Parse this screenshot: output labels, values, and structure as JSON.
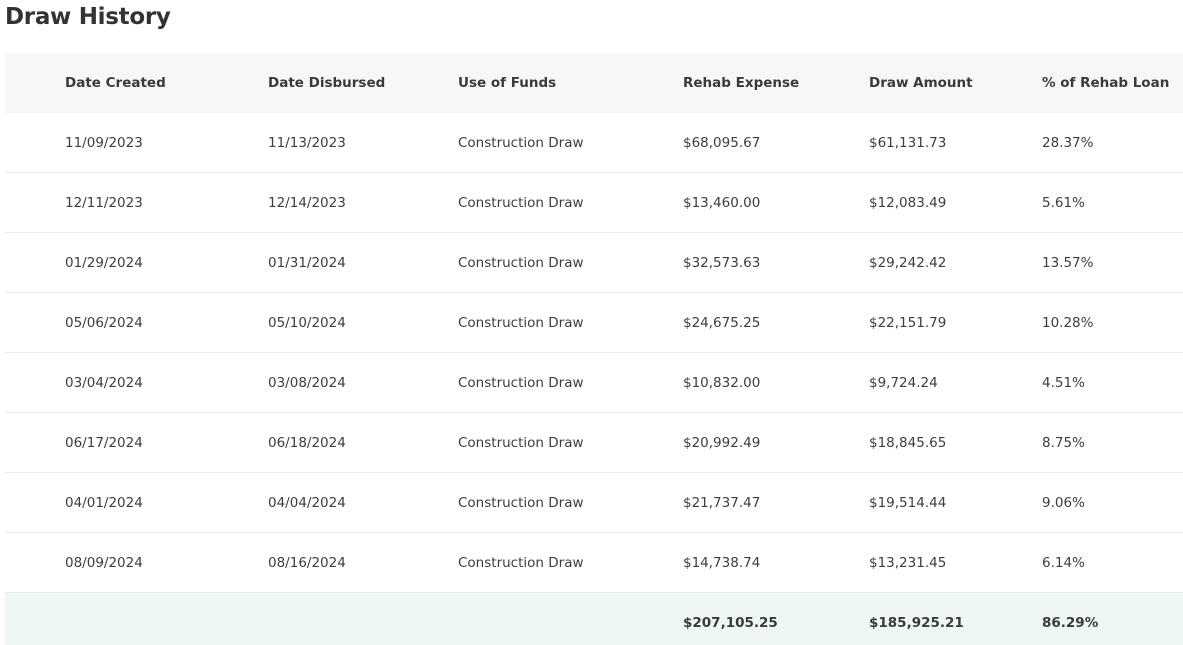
{
  "title": "Draw History",
  "columns": [
    "Date Created",
    "Date Disbursed",
    "Use of Funds",
    "Rehab Expense",
    "Draw Amount",
    "% of Rehab Loan"
  ],
  "rows": [
    [
      "11/09/2023",
      "11/13/2023",
      "Construction Draw",
      "$68,095.67",
      "$61,131.73",
      "28.37%"
    ],
    [
      "12/11/2023",
      "12/14/2023",
      "Construction Draw",
      "$13,460.00",
      "$12,083.49",
      "5.61%"
    ],
    [
      "01/29/2024",
      "01/31/2024",
      "Construction Draw",
      "$32,573.63",
      "$29,242.42",
      "13.57%"
    ],
    [
      "05/06/2024",
      "05/10/2024",
      "Construction Draw",
      "$24,675.25",
      "$22,151.79",
      "10.28%"
    ],
    [
      "03/04/2024",
      "03/08/2024",
      "Construction Draw",
      "$10,832.00",
      "$9,724.24",
      "4.51%"
    ],
    [
      "06/17/2024",
      "06/18/2024",
      "Construction Draw",
      "$20,992.49",
      "$18,845.65",
      "8.75%"
    ],
    [
      "04/01/2024",
      "04/04/2024",
      "Construction Draw",
      "$21,737.47",
      "$19,514.44",
      "9.06%"
    ],
    [
      "08/09/2024",
      "08/16/2024",
      "Construction Draw",
      "$14,738.74",
      "$13,231.45",
      "6.14%"
    ]
  ],
  "totals": {
    "rehab_expense": "$207,105.25",
    "draw_amount": "$185,925.21",
    "percent_rehab_loan": "86.29%"
  }
}
